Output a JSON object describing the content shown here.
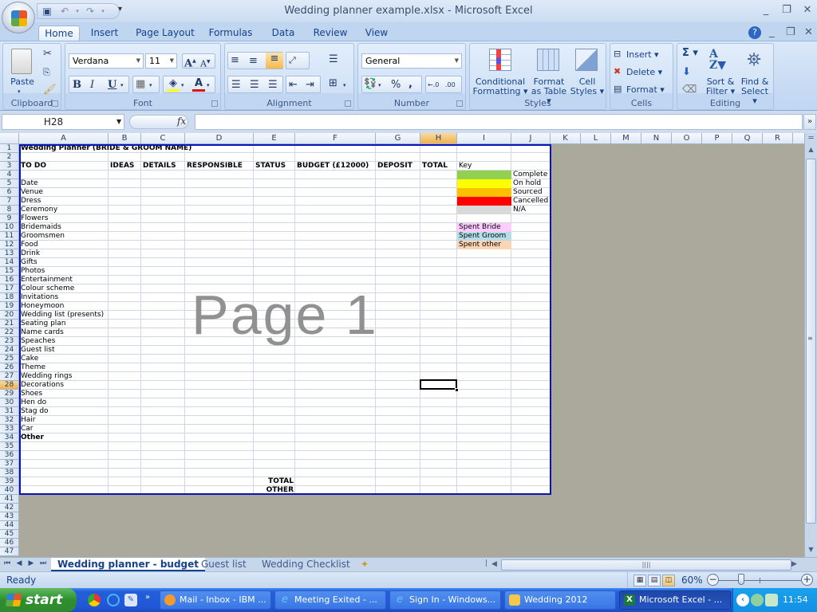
{
  "window": {
    "title": "Wedding planner example.xlsx - Microsoft Excel",
    "controls": [
      "minimize",
      "restore",
      "close"
    ]
  },
  "quick_access": {
    "items": [
      "save-icon",
      "undo-icon",
      "redo-icon"
    ],
    "customize_glyph": "▾"
  },
  "ribbon": {
    "tabs": [
      {
        "label": "Home",
        "active": true
      },
      {
        "label": "Insert"
      },
      {
        "label": "Page Layout"
      },
      {
        "label": "Formulas"
      },
      {
        "label": "Data"
      },
      {
        "label": "Review"
      },
      {
        "label": "View"
      }
    ],
    "groups": {
      "clipboard": {
        "label": "Clipboard",
        "paste": "Paste"
      },
      "font": {
        "label": "Font",
        "font_name": "Verdana",
        "font_size": "11",
        "bold": "B",
        "italic": "I",
        "underline": "U",
        "grow": "A",
        "shrink": "A"
      },
      "alignment": {
        "label": "Alignment"
      },
      "number": {
        "label": "Number",
        "format": "General",
        "percent": "%",
        "comma": ",",
        "inc_decimal": ".0→.00",
        "dec_decimal": ".00→.0"
      },
      "styles": {
        "label": "Styles",
        "conditional_1": "Conditional",
        "conditional_2": "Formatting ▾",
        "format_table_1": "Format",
        "format_table_2": "as Table ▾",
        "cell_styles_1": "Cell",
        "cell_styles_2": "Styles ▾"
      },
      "cells": {
        "label": "Cells",
        "insert": "Insert ▾",
        "delete": "Delete ▾",
        "format": "Format ▾"
      },
      "editing": {
        "label": "Editing",
        "sum": "Σ ▾",
        "sort_1": "Sort &",
        "sort_2": "Filter ▾",
        "find_1": "Find &",
        "find_2": "Select ▾"
      }
    }
  },
  "formula_bar": {
    "name_box": "H28",
    "fx": "fx",
    "value": ""
  },
  "grid": {
    "columns": [
      "A",
      "B",
      "C",
      "D",
      "E",
      "F",
      "G",
      "H",
      "I",
      "J",
      "K",
      "L",
      "M",
      "N",
      "O",
      "P",
      "Q",
      "R"
    ],
    "selected_column": "H",
    "rows": [
      "1",
      "2",
      "3",
      "4",
      "5",
      "6",
      "7",
      "8",
      "9",
      "10",
      "11",
      "12",
      "13",
      "14",
      "15",
      "16",
      "17",
      "18",
      "19",
      "20",
      "21",
      "22",
      "23",
      "24",
      "25",
      "26",
      "27",
      "28",
      "29",
      "30",
      "31",
      "32",
      "33",
      "34",
      "35",
      "36",
      "37",
      "38",
      "39",
      "40",
      "41",
      "42",
      "43",
      "44",
      "45",
      "46",
      "47"
    ],
    "selected_row": "28",
    "active_cell": "H28",
    "zoom_watermark": "Page 1"
  },
  "sheet": {
    "title": "Wedding Planner (BRIDE & GROOM NAME)",
    "headers": [
      "TO DO",
      "IDEAS",
      "DETAILS",
      "RESPONSIBLE",
      "STATUS",
      "BUDGET (£12000)",
      "DEPOSIT",
      "TOTAL"
    ],
    "todo_items": [
      "Date",
      "Venue",
      "Dress",
      "Ceremony",
      "Flowers",
      "Bridemaids",
      "Groomsmen",
      "Food",
      "Drink",
      "Gifts",
      "Photos",
      "Entertainment",
      "Colour scheme",
      "Invitations",
      "Honeymoon",
      "Wedding list (presents)",
      "Seating plan",
      "Name cards",
      "Speaches",
      "Guest list",
      "Cake",
      "Theme",
      "Wedding rings",
      "Decorations",
      "Shoes",
      "Hen do",
      "Stag do",
      "Hair",
      "Car"
    ],
    "other_label": "Other",
    "total_label": "TOTAL",
    "total_other_label": "OTHER",
    "key": {
      "label": "Key",
      "status_items": [
        {
          "label": "Complete",
          "color": "#92d050"
        },
        {
          "label": "On hold",
          "color": "#ffff00"
        },
        {
          "label": "Sourced",
          "color": "#ffc000"
        },
        {
          "label": "Cancelled",
          "color": "#ff0000"
        },
        {
          "label": "N/A",
          "color": "#d9d9d9"
        }
      ],
      "spend_items": [
        {
          "label": "Spent Bride",
          "color": "#ffccff"
        },
        {
          "label": "Spent Groom",
          "color": "#b7dee8"
        },
        {
          "label": "Spent other",
          "color": "#fcd5b4"
        }
      ]
    }
  },
  "sheet_tabs": {
    "tabs": [
      {
        "label": "Wedding planner - budget",
        "active": true
      },
      {
        "label": "Guest list"
      },
      {
        "label": "Wedding Checklist"
      }
    ]
  },
  "status_bar": {
    "status": "Ready",
    "zoom": "60%",
    "zoom_value": 0.6,
    "view_mode": "page-break-preview"
  },
  "taskbar": {
    "start_label": "start",
    "quick_launch": [
      "chrome-icon",
      "quicktime-icon",
      "app-icon"
    ],
    "tasks": [
      {
        "label": "Mail - Inbox - IBM ...",
        "icon": "mail-icon"
      },
      {
        "label": "Meeting Exited - ...",
        "icon": "ie-icon"
      },
      {
        "label": "Sign In - Windows...",
        "icon": "ie-icon"
      },
      {
        "label": "Wedding 2012",
        "icon": "folder-icon"
      },
      {
        "label": "Microsoft Excel - ...",
        "icon": "excel-icon",
        "active": true
      }
    ],
    "clock": "11:54"
  }
}
